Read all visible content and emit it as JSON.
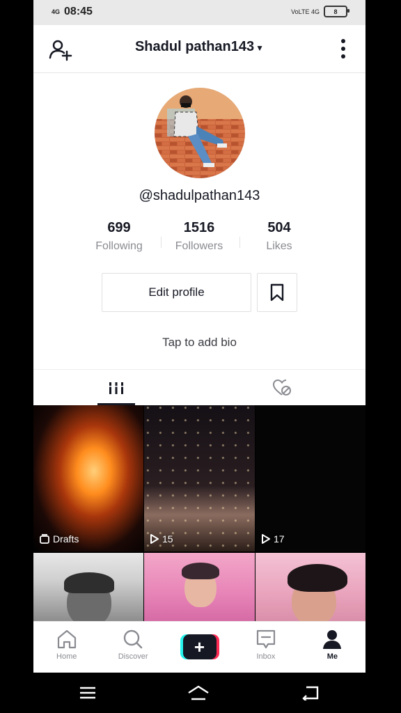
{
  "status_bar": {
    "signal": "4G",
    "time": "08:45",
    "network": "VoLTE 4G",
    "battery": "8"
  },
  "header": {
    "title": "Shadul pathan143"
  },
  "profile": {
    "username": "@shadulpathan143",
    "bio_prompt": "Tap to add bio"
  },
  "stats": [
    {
      "value": "699",
      "label": "Following"
    },
    {
      "value": "1516",
      "label": "Followers"
    },
    {
      "value": "504",
      "label": "Likes"
    }
  ],
  "buttons": {
    "edit_profile": "Edit profile"
  },
  "videos": [
    {
      "overlay": "Drafts",
      "icon": "drafts-icon"
    },
    {
      "overlay": "15",
      "icon": "play-icon"
    },
    {
      "overlay": "17",
      "icon": "play-icon"
    },
    {
      "overlay": "",
      "icon": ""
    },
    {
      "overlay": "",
      "icon": ""
    },
    {
      "overlay": "",
      "icon": ""
    }
  ],
  "bottom_nav": [
    {
      "label": "Home",
      "icon": "home-icon"
    },
    {
      "label": "Discover",
      "icon": "search-icon"
    },
    {
      "label": "",
      "icon": "plus-icon"
    },
    {
      "label": "Inbox",
      "icon": "inbox-icon"
    },
    {
      "label": "Me",
      "icon": "profile-icon"
    }
  ]
}
